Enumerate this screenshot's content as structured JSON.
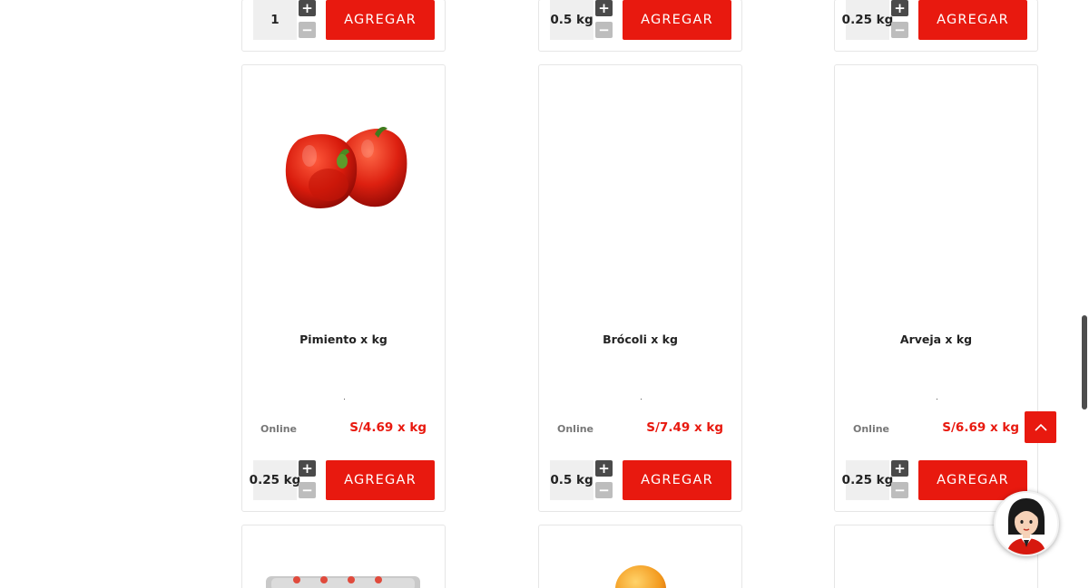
{
  "top_row": [
    {
      "qty": "1",
      "add_label": "AGREGAR"
    },
    {
      "qty": "0.5 kg",
      "add_label": "AGREGAR"
    },
    {
      "qty": "0.25 kg",
      "add_label": "AGREGAR"
    }
  ],
  "products": [
    {
      "name": "Pimiento x kg",
      "availability": "Online",
      "price": "S/4.69 x kg",
      "qty": "0.25 kg",
      "add_label": "AGREGAR",
      "image_icon": "red-bell-pepper"
    },
    {
      "name": "Brócoli x kg",
      "availability": "Online",
      "price": "S/7.49 x kg",
      "qty": "0.5 kg",
      "add_label": "AGREGAR",
      "image_icon": "none"
    },
    {
      "name": "Arveja x kg",
      "availability": "Online",
      "price": "S/6.69 x kg",
      "qty": "0.25 kg",
      "add_label": "AGREGAR",
      "image_icon": "none"
    }
  ],
  "stepper": {
    "plus": "+",
    "minus": "−"
  },
  "colors": {
    "accent": "#e8190f",
    "stepper_plus": "#4a4a4a",
    "stepper_minus": "#bdbdbd",
    "qty_bg": "#efefef"
  },
  "icons": {
    "scroll_top": "chevron-up-icon",
    "assistant": "assistant-avatar-icon"
  }
}
